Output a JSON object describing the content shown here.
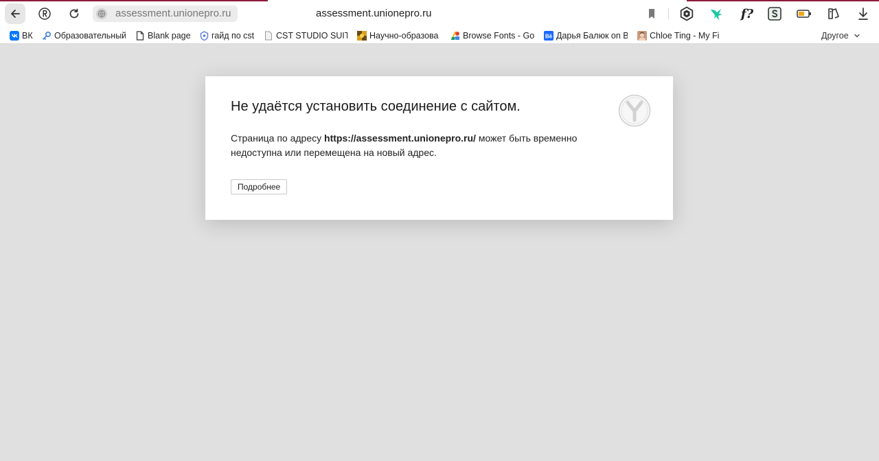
{
  "browser": {
    "url": "assessment.unionepro.ru",
    "page_title": "assessment.unionepro.ru"
  },
  "bookmarks": [
    {
      "label": "ВК",
      "icon": "vk-icon"
    },
    {
      "label": "Образовательный",
      "icon": "key-icon"
    },
    {
      "label": "Blank page",
      "icon": "page-icon"
    },
    {
      "label": "гайд по cst",
      "icon": "shield-icon"
    },
    {
      "label": "CST STUDIO SUITE",
      "icon": "file-icon"
    },
    {
      "label": "Научно-образова",
      "icon": "yellow-tile-icon"
    },
    {
      "label": "Browse Fonts - Go",
      "icon": "google-fonts-icon"
    },
    {
      "label": "Дарья Балюк on B",
      "icon": "behance-icon"
    },
    {
      "label": "Chloe Ting - My Fi",
      "icon": "avatar-icon"
    }
  ],
  "bookmarks_other": "Другое",
  "error": {
    "title": "Не удаётся установить соединение с сайтом.",
    "msg_prefix": "Страница по адресу ",
    "msg_url": "https://assessment.unionepro.ru/",
    "msg_suffix": " может быть временно недоступна или перемещена на новый адрес.",
    "more_button": "Подробнее"
  }
}
